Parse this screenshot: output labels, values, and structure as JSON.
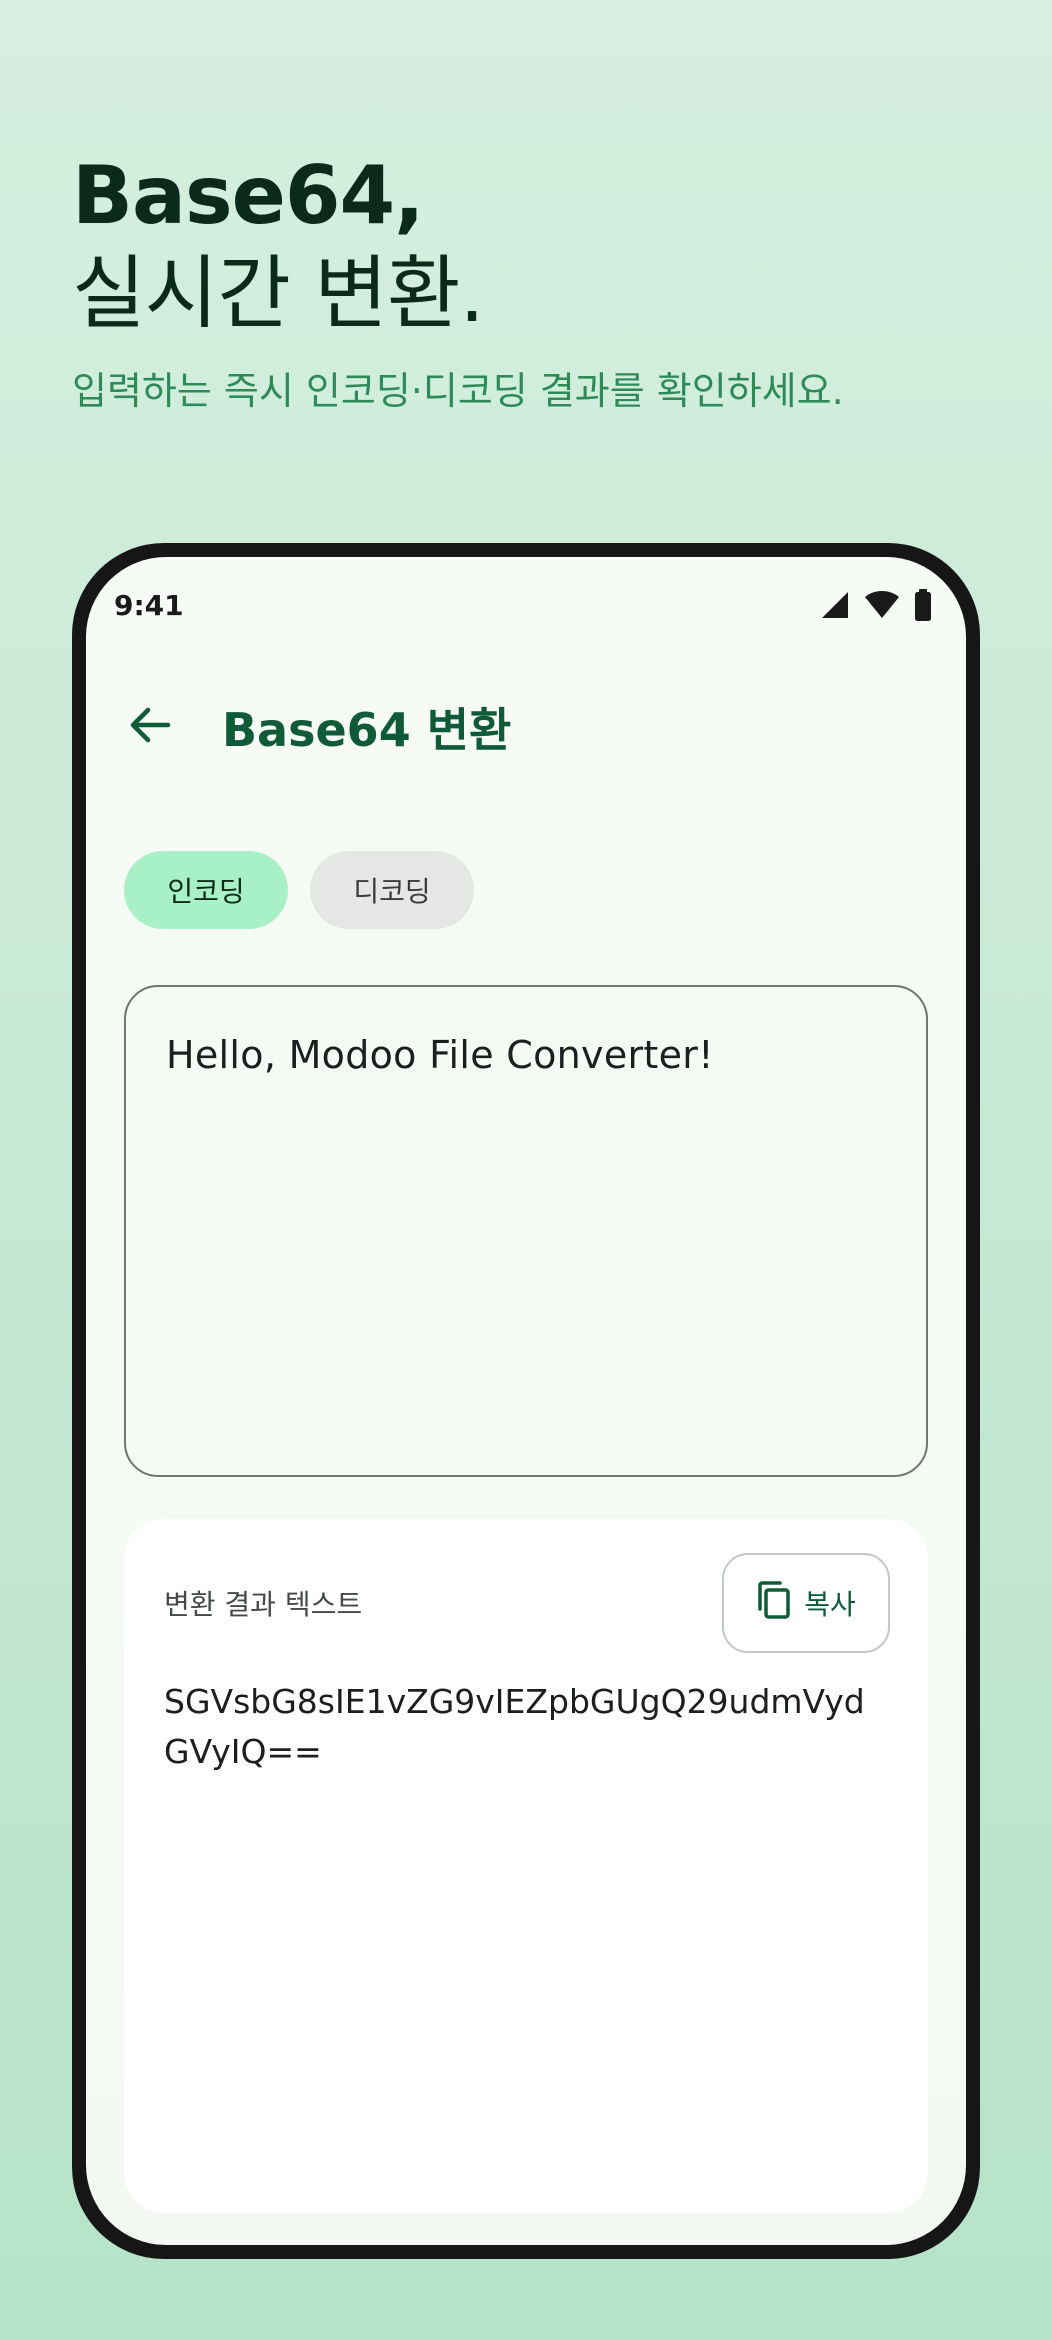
{
  "promo": {
    "title_line1": "Base64,",
    "title_line2": "실시간 변환.",
    "subtitle": "입력하는 즉시 인코딩·디코딩 결과를 확인하세요."
  },
  "status_bar": {
    "time": "9:41",
    "icons": [
      "signal-icon",
      "wifi-icon",
      "battery-icon"
    ]
  },
  "app_bar": {
    "back_icon": "arrow-left-icon",
    "title": "Base64 변환"
  },
  "mode_chips": [
    {
      "label": "인코딩",
      "selected": true
    },
    {
      "label": "디코딩",
      "selected": false
    }
  ],
  "input": {
    "value": "Hello, Modoo File Converter!"
  },
  "result": {
    "label": "변환 결과 텍스트",
    "copy_label": "복사",
    "copy_icon": "copy-icon",
    "text": "SGVsbG8sIE1vZG9vIEZpbGUgQ29udmVydGVyIQ=="
  },
  "colors": {
    "accent": "#0f5a37",
    "chip_active_bg": "#a8f0c6",
    "chip_inactive_bg": "#e4e7e3",
    "subtitle": "#2e8a58",
    "background_top": "#d6efe0",
    "background_bottom": "#b6e3c9"
  }
}
